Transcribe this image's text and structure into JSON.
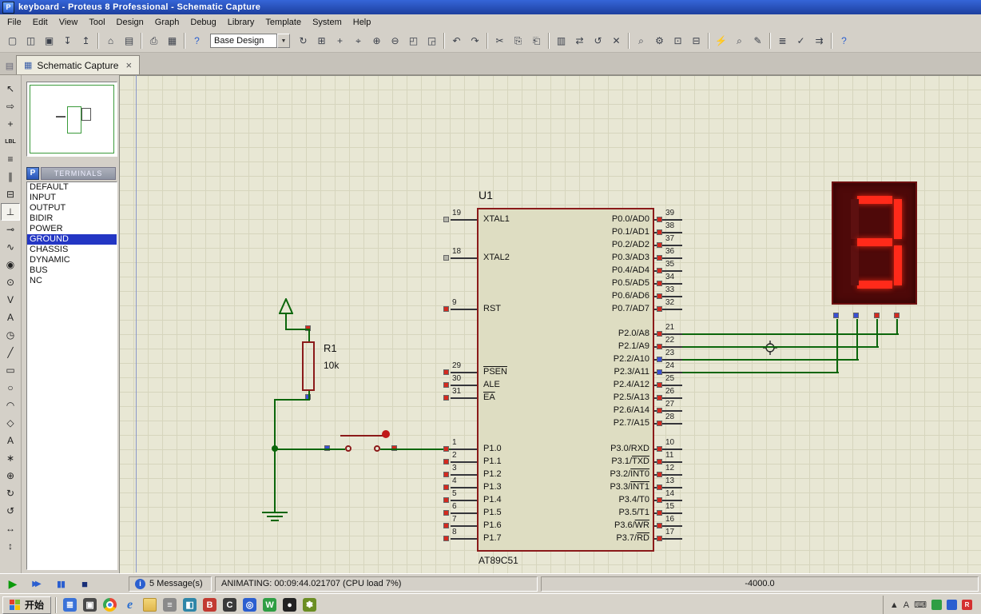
{
  "window": {
    "title": "keyboard - Proteus 8 Professional - Schematic Capture",
    "app_icon_letter": "P"
  },
  "menu": {
    "items": [
      "File",
      "Edit",
      "View",
      "Tool",
      "Design",
      "Graph",
      "Debug",
      "Library",
      "Template",
      "System",
      "Help"
    ]
  },
  "toolbar": {
    "design_select": "Base Design",
    "buttons": [
      {
        "g": "▢",
        "n": "new-project"
      },
      {
        "g": "◫",
        "n": "open-project"
      },
      {
        "g": "▣",
        "n": "save-project"
      },
      {
        "g": "↧",
        "n": "import-section"
      },
      {
        "g": "↥",
        "n": "export-section"
      },
      {
        "sep": 1
      },
      {
        "g": "⌂",
        "n": "home-page"
      },
      {
        "g": "▤",
        "n": "design-explorer"
      },
      {
        "sep": 1
      },
      {
        "g": "⎙",
        "n": "print-design"
      },
      {
        "g": "▦",
        "n": "mark-output-area"
      },
      {
        "sep": 1
      },
      {
        "g": "?",
        "n": "context-help",
        "c": "#2b5fd0"
      },
      {
        "combo": 1
      },
      {
        "g": "↻",
        "n": "redraw-display"
      },
      {
        "g": "⊞",
        "n": "toggle-grid"
      },
      {
        "g": "+",
        "n": "toggle-false-origin"
      },
      {
        "g": "⌖",
        "n": "center-at-cursor"
      },
      {
        "g": "⊕",
        "n": "zoom-in"
      },
      {
        "g": "⊖",
        "n": "zoom-out"
      },
      {
        "g": "◰",
        "n": "zoom-extents"
      },
      {
        "g": "◲",
        "n": "zoom-to-area"
      },
      {
        "sep": 1
      },
      {
        "g": "↶",
        "n": "undo"
      },
      {
        "g": "↷",
        "n": "redo"
      },
      {
        "sep": 1
      },
      {
        "g": "✂",
        "n": "cut-to-clipboard"
      },
      {
        "g": "⎘",
        "n": "copy-to-clipboard"
      },
      {
        "g": "⎗",
        "n": "paste-from-clipboard"
      },
      {
        "sep": 1
      },
      {
        "g": "▥",
        "n": "block-copy"
      },
      {
        "g": "⇄",
        "n": "block-move"
      },
      {
        "g": "↺",
        "n": "block-rotate"
      },
      {
        "g": "✕",
        "n": "block-delete"
      },
      {
        "sep": 1
      },
      {
        "g": "⌕",
        "n": "pick-parts-from-libraries"
      },
      {
        "g": "⚙",
        "n": "make-device"
      },
      {
        "g": "⊡",
        "n": "packaging-tool"
      },
      {
        "g": "⊟",
        "n": "decompose"
      },
      {
        "sep": 1
      },
      {
        "g": "⚡",
        "n": "wire-autorouter",
        "c": "#1f8a1f"
      },
      {
        "g": "⌕",
        "n": "search-and-tag"
      },
      {
        "g": "✎",
        "n": "property-assignment-tool"
      },
      {
        "sep": 1
      },
      {
        "g": "≣",
        "n": "bill-of-materials"
      },
      {
        "g": "✓",
        "n": "electrical-rules-check"
      },
      {
        "g": "⇉",
        "n": "netlist-compiler"
      },
      {
        "sep": 1
      },
      {
        "g": "?",
        "n": "help",
        "c": "#2b5fd0"
      }
    ]
  },
  "tab": {
    "label": "Schematic Capture"
  },
  "left_tools": [
    {
      "g": "↖",
      "n": "selection-mode"
    },
    {
      "g": "⇨",
      "n": "component-mode"
    },
    {
      "g": "+",
      "n": "junction-dot-mode"
    },
    {
      "g": "LBL",
      "n": "wire-label-mode",
      "fs": "7px"
    },
    {
      "g": "≡",
      "n": "text-script-mode"
    },
    {
      "g": "∥",
      "n": "buses-mode"
    },
    {
      "g": "⊟",
      "n": "subcircuit-mode"
    },
    {
      "g": "⊥",
      "n": "terminals-mode",
      "active": true
    },
    {
      "g": "⊸",
      "n": "device-pins-mode"
    },
    {
      "g": "∿",
      "n": "graph-mode"
    },
    {
      "g": "◉",
      "n": "tape-recorder-mode"
    },
    {
      "g": "⊙",
      "n": "generator-mode"
    },
    {
      "g": "V",
      "n": "voltage-probe-mode"
    },
    {
      "g": "A",
      "n": "current-probe-mode"
    },
    {
      "g": "◷",
      "n": "virtual-instruments-mode"
    },
    {
      "g": "╱",
      "n": "2d-line"
    },
    {
      "g": "▭",
      "n": "2d-box"
    },
    {
      "g": "○",
      "n": "2d-circle"
    },
    {
      "g": "◠",
      "n": "2d-arc"
    },
    {
      "g": "◇",
      "n": "2d-path"
    },
    {
      "g": "A",
      "n": "2d-text"
    },
    {
      "g": "∗",
      "n": "2d-symbol"
    },
    {
      "g": "⊕",
      "n": "2d-marker"
    },
    {
      "g": "↻",
      "n": "rotate-clockwise"
    },
    {
      "g": "↺",
      "n": "rotate-anticlockwise"
    },
    {
      "g": "↔",
      "n": "mirror-horizontal"
    },
    {
      "g": "↕",
      "n": "mirror-vertical"
    }
  ],
  "terminals_panel": {
    "title": "TERMINALS",
    "picker_label": "P",
    "items": [
      "DEFAULT",
      "INPUT",
      "OUTPUT",
      "BIDIR",
      "POWER",
      "GROUND",
      "CHASSIS",
      "DYNAMIC",
      "BUS",
      "NC"
    ],
    "selected": "GROUND"
  },
  "schematic": {
    "u1": {
      "ref": "U1",
      "part": "AT89C51",
      "left_pins": [
        {
          "num": "19",
          "parts": [
            [
              "XTAL1",
              0
            ]
          ]
        },
        {
          "num": "18",
          "parts": [
            [
              "XTAL2",
              0
            ]
          ]
        },
        {
          "num": "9",
          "parts": [
            [
              "RST",
              0
            ]
          ]
        },
        {
          "num": "29",
          "parts": [
            [
              "PSEN",
              1
            ]
          ]
        },
        {
          "num": "30",
          "parts": [
            [
              "ALE",
              0
            ]
          ]
        },
        {
          "num": "31",
          "parts": [
            [
              "EA",
              1
            ]
          ]
        },
        {
          "num": "1",
          "parts": [
            [
              "P1.0",
              0
            ]
          ]
        },
        {
          "num": "2",
          "parts": [
            [
              "P1.1",
              0
            ]
          ]
        },
        {
          "num": "3",
          "parts": [
            [
              "P1.2",
              0
            ]
          ]
        },
        {
          "num": "4",
          "parts": [
            [
              "P1.3",
              0
            ]
          ]
        },
        {
          "num": "5",
          "parts": [
            [
              "P1.4",
              0
            ]
          ]
        },
        {
          "num": "6",
          "parts": [
            [
              "P1.5",
              0
            ]
          ]
        },
        {
          "num": "7",
          "parts": [
            [
              "P1.6",
              0
            ]
          ]
        },
        {
          "num": "8",
          "parts": [
            [
              "P1.7",
              0
            ]
          ]
        }
      ],
      "right_pins": [
        {
          "num": "39",
          "parts": [
            [
              "P0.0/AD0",
              0
            ]
          ]
        },
        {
          "num": "38",
          "parts": [
            [
              "P0.1/AD1",
              0
            ]
          ]
        },
        {
          "num": "37",
          "parts": [
            [
              "P0.2/AD2",
              0
            ]
          ]
        },
        {
          "num": "36",
          "parts": [
            [
              "P0.3/AD3",
              0
            ]
          ]
        },
        {
          "num": "35",
          "parts": [
            [
              "P0.4/AD4",
              0
            ]
          ]
        },
        {
          "num": "34",
          "parts": [
            [
              "P0.5/AD5",
              0
            ]
          ]
        },
        {
          "num": "33",
          "parts": [
            [
              "P0.6/AD6",
              0
            ]
          ]
        },
        {
          "num": "32",
          "parts": [
            [
              "P0.7/AD7",
              0
            ]
          ]
        },
        {
          "num": "21",
          "parts": [
            [
              "P2.0/A8",
              0
            ]
          ]
        },
        {
          "num": "22",
          "parts": [
            [
              "P2.1/A9",
              0
            ]
          ]
        },
        {
          "num": "23",
          "parts": [
            [
              "P2.2/A10",
              0
            ]
          ]
        },
        {
          "num": "24",
          "parts": [
            [
              "P2.3/A11",
              0
            ]
          ]
        },
        {
          "num": "25",
          "parts": [
            [
              "P2.4/A12",
              0
            ]
          ]
        },
        {
          "num": "26",
          "parts": [
            [
              "P2.5/A13",
              0
            ]
          ]
        },
        {
          "num": "27",
          "parts": [
            [
              "P2.6/A14",
              0
            ]
          ]
        },
        {
          "num": "28",
          "parts": [
            [
              "P2.7/A15",
              0
            ]
          ]
        },
        {
          "num": "10",
          "parts": [
            [
              "P3.0/RXD",
              0
            ]
          ]
        },
        {
          "num": "11",
          "parts": [
            [
              "P3.1/",
              0
            ],
            [
              "TXD",
              1
            ]
          ]
        },
        {
          "num": "12",
          "parts": [
            [
              "P3.2/",
              0
            ],
            [
              "INT0",
              1
            ]
          ]
        },
        {
          "num": "13",
          "parts": [
            [
              "P3.3/",
              0
            ],
            [
              "INT1",
              1
            ]
          ]
        },
        {
          "num": "14",
          "parts": [
            [
              "P3.4/T0",
              0
            ]
          ]
        },
        {
          "num": "15",
          "parts": [
            [
              "P3.5/T1",
              0
            ]
          ]
        },
        {
          "num": "16",
          "parts": [
            [
              "P3.6/",
              0
            ],
            [
              "WR",
              1
            ]
          ]
        },
        {
          "num": "17",
          "parts": [
            [
              "P3.7/",
              0
            ],
            [
              "RD",
              1
            ]
          ]
        }
      ]
    },
    "r1": {
      "ref": "R1",
      "value": "10k"
    },
    "display": {
      "digit": "3",
      "lit_segments": [
        "a",
        "b",
        "c",
        "d",
        "g"
      ],
      "pin_states": [
        "blue",
        "blue",
        "red",
        "red"
      ]
    },
    "pin_states": {
      "left": [
        "gray",
        "gray",
        "red",
        "red",
        "red",
        "red",
        "red",
        "red",
        "red",
        "red",
        "red",
        "red",
        "red",
        "red"
      ],
      "right": [
        "red",
        "red",
        "red",
        "red",
        "red",
        "red",
        "red",
        "red",
        "red",
        "red",
        "blue",
        "blue",
        "red",
        "red",
        "red",
        "red",
        "red",
        "red",
        "red",
        "red",
        "red",
        "red",
        "red",
        "red"
      ]
    },
    "state_colors": {
      "red": "#d42a20",
      "blue": "#3a50d4",
      "gray": "#b4b4aa"
    },
    "wire_color": "#0b660b"
  },
  "statusbar": {
    "messages": "5 Message(s)",
    "animating": "ANIMATING: 00:09:44.021707 (CPU load 7%)",
    "coordinate": "-4000.0"
  },
  "taskbar": {
    "start_label": "开始",
    "quick_launch": [
      {
        "color": "#3a72d8",
        "t": "≣"
      },
      {
        "color": "#4a4a4a",
        "t": "▣"
      },
      {
        "kind": "chrome"
      },
      {
        "kind": "ie"
      },
      {
        "kind": "folder"
      },
      {
        "color": "#8a8a8a",
        "t": "≡"
      },
      {
        "color": "#2f86a8",
        "t": "◧"
      },
      {
        "color": "#c23a32",
        "t": "B"
      },
      {
        "color": "#3a3a3a",
        "t": "C"
      },
      {
        "color": "#2b5fd0",
        "t": "◎"
      },
      {
        "color": "#2f9e44",
        "t": "W"
      },
      {
        "color": "#222222",
        "t": "●"
      },
      {
        "color": "#6b8e23",
        "t": "✽"
      }
    ],
    "tray": [
      {
        "n": "tray-hidden-icons",
        "t": "▲"
      },
      {
        "n": "tray-input-lang",
        "t": "A"
      },
      {
        "n": "tray-keyboard-icon",
        "t": "⌨"
      },
      {
        "n": "tray-icon-green",
        "box": "#2f9e44"
      },
      {
        "n": "tray-icon-blue",
        "box": "#2b5fd0"
      },
      {
        "n": "tray-icon-red",
        "box": "#d43030",
        "t": "R"
      }
    ]
  }
}
